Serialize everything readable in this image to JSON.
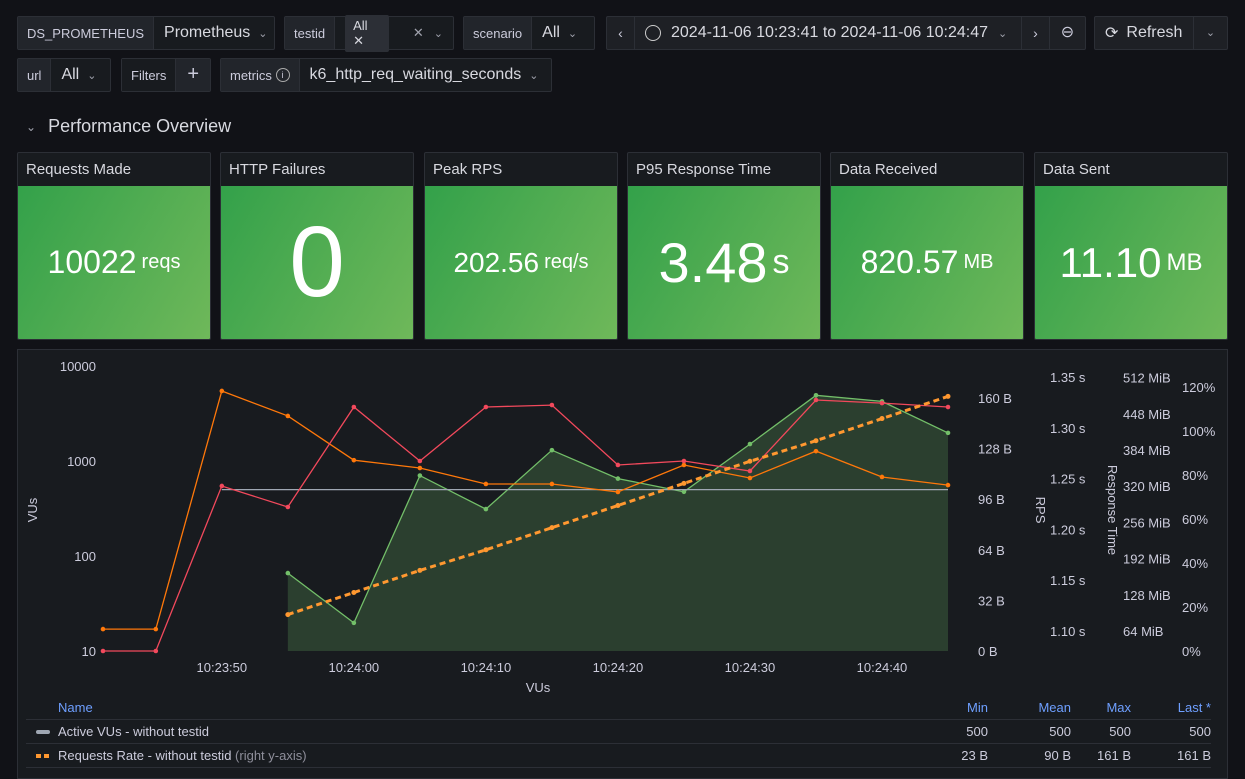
{
  "toolbar": {
    "datasource": {
      "label": "DS_PROMETHEUS",
      "value": "Prometheus"
    },
    "testid": {
      "label": "testid",
      "chip": "All"
    },
    "scenario": {
      "label": "scenario",
      "value": "All"
    },
    "time_range": "2024-11-06 10:23:41 to 2024-11-06 10:24:47",
    "refresh": "Refresh",
    "url": {
      "label": "url",
      "value": "All"
    },
    "filters": "Filters",
    "metrics": {
      "label": "metrics",
      "value": "k6_http_req_waiting_seconds"
    }
  },
  "row_title": "Performance Overview",
  "stats": [
    {
      "title": "Requests Made",
      "value": "10022",
      "unit": "reqs"
    },
    {
      "title": "HTTP Failures",
      "value": "0",
      "unit": ""
    },
    {
      "title": "Peak RPS",
      "value": "202.56",
      "unit": "req/s"
    },
    {
      "title": "P95 Response Time",
      "value": "3.48",
      "unit": "s"
    },
    {
      "title": "Data Received",
      "value": "820.57",
      "unit": "MB"
    },
    {
      "title": "Data Sent",
      "value": "11.10",
      "unit": "MB"
    }
  ],
  "colors": {
    "green": "#73bf69",
    "orange": "#ff9830",
    "orange_dark": "#ff780a",
    "red": "#f2495c",
    "grey": "#9fa7b3",
    "legend_header": "#6e9fff"
  },
  "chart_data": {
    "type": "line",
    "xlabel": "VUs",
    "x_ticks": [
      "10:23:50",
      "10:24:00",
      "10:24:10",
      "10:24:20",
      "10:24:30",
      "10:24:40"
    ],
    "x_range": [
      "10:23:41",
      "10:24:45"
    ],
    "y_left": {
      "label": "VUs",
      "scale": "log",
      "ticks": [
        "10",
        "100",
        "1000",
        "10000"
      ],
      "range": [
        10,
        10000
      ]
    },
    "y_bytes": {
      "ticks": [
        "0 B",
        "32 B",
        "64 B",
        "96 B",
        "128 B",
        "160 B"
      ],
      "range": [
        0,
        160
      ]
    },
    "y_rps": {
      "label": "RPS",
      "ticks": [
        "1.10 s",
        "1.15 s",
        "1.20 s",
        "1.25 s",
        "1.30 s",
        "1.35 s"
      ],
      "range": [
        1.1,
        1.35
      ]
    },
    "y_mib": {
      "label": "Response Time",
      "ticks": [
        "64 MiB",
        "128 MiB",
        "192 MiB",
        "256 MiB",
        "320 MiB",
        "384 MiB",
        "448 MiB",
        "512 MiB"
      ]
    },
    "y_pct": {
      "ticks": [
        "0%",
        "20%",
        "40%",
        "60%",
        "80%",
        "100%",
        "120%"
      ]
    },
    "series": [
      {
        "name": "Active VUs - without testid",
        "axis": "left",
        "color": "#9fa7b3",
        "x": [
          "10:23:50",
          "10:24:45"
        ],
        "y": [
          500,
          500
        ]
      },
      {
        "name": "Requests Rate - without testid",
        "axis": "bytes",
        "color": "#ff9830",
        "dashed": true,
        "x": [
          "10:23:55",
          "10:24:00",
          "10:24:05",
          "10:24:10",
          "10:24:15",
          "10:24:20",
          "10:24:25",
          "10:24:30",
          "10:24:35",
          "10:24:40",
          "10:24:45"
        ],
        "y": [
          23,
          37,
          51,
          64,
          78,
          92,
          106,
          120,
          133,
          147,
          161
        ]
      },
      {
        "axis": "left",
        "color": "#ff780a",
        "x": [
          "10:23:41",
          "10:23:45",
          "10:23:50",
          "10:23:55",
          "10:24:00",
          "10:24:05",
          "10:24:10",
          "10:24:15",
          "10:24:20",
          "10:24:25",
          "10:24:30",
          "10:24:35",
          "10:24:40",
          "10:24:45"
        ],
        "y": [
          17,
          17,
          5460,
          2980,
          1020,
          843,
          573,
          573,
          472,
          908,
          662,
          1270,
          679,
          558
        ]
      },
      {
        "axis": "left",
        "color": "#f2495c",
        "x": [
          "10:23:41",
          "10:23:45",
          "10:23:50",
          "10:23:55",
          "10:24:00",
          "10:24:05",
          "10:24:10",
          "10:24:15",
          "10:24:20",
          "10:24:25",
          "10:24:30",
          "10:24:35",
          "10:24:40",
          "10:24:45"
        ],
        "y": [
          10,
          10,
          546,
          328,
          3700,
          1000,
          3700,
          3880,
          908,
          1000,
          785,
          4390,
          4070,
          3700
        ]
      },
      {
        "axis": "rps",
        "color": "#73bf69",
        "fill": true,
        "x": [
          "10:23:55",
          "10:24:00",
          "10:24:05",
          "10:24:10",
          "10:24:15",
          "10:24:20",
          "10:24:25",
          "10:24:30",
          "10:24:35",
          "10:24:40",
          "10:24:45"
        ],
        "y": [
          1.157,
          1.108,
          1.253,
          1.22,
          1.278,
          1.25,
          1.237,
          1.284,
          1.332,
          1.326,
          1.295
        ]
      }
    ]
  },
  "legend": {
    "headers": {
      "name": "Name",
      "min": "Min",
      "mean": "Mean",
      "max": "Max",
      "last": "Last *"
    },
    "rows": [
      {
        "name": "Active VUs - without testid",
        "suffix": "",
        "min": "500",
        "mean": "500",
        "max": "500",
        "last": "500"
      },
      {
        "name": "Requests Rate - without testid",
        "suffix": "(right y-axis)",
        "min": "23 B",
        "mean": "90 B",
        "max": "161 B",
        "last": "161 B"
      }
    ]
  }
}
